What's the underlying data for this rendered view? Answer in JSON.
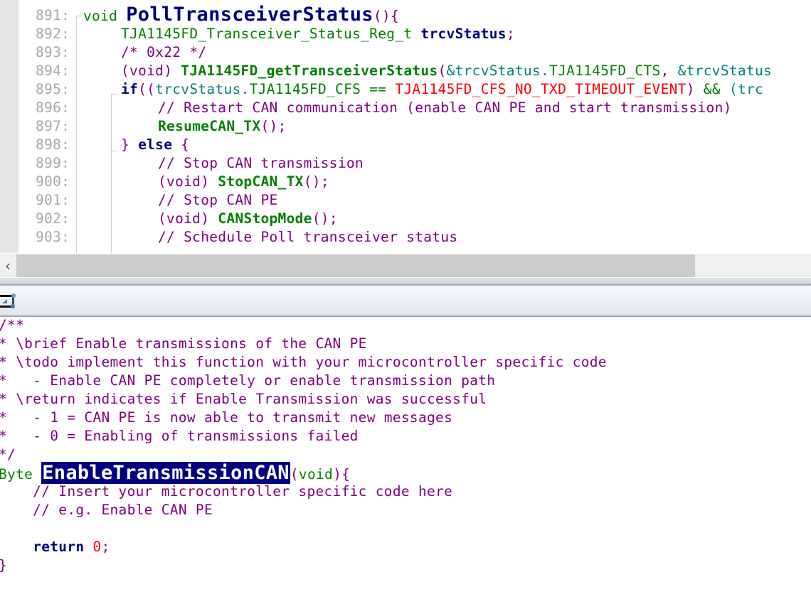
{
  "top_editor": {
    "lines": [
      {
        "num": "891:",
        "tokens": [
          {
            "t": "void ",
            "c": "ty"
          },
          {
            "t": "PollTransceiverStatus",
            "c": "fnbig"
          },
          {
            "t": "(){",
            "c": "pu"
          }
        ]
      },
      {
        "num": "892:",
        "tokens": [
          {
            "t": "TJA1145FD_Transceiver_Status_Reg_t ",
            "c": "ty"
          },
          {
            "t": "trcvStatus",
            "c": "var"
          },
          {
            "t": ";",
            "c": "pu"
          }
        ]
      },
      {
        "num": "893:",
        "tokens": [
          {
            "t": "/* 0x22 */",
            "c": "cm"
          }
        ]
      },
      {
        "num": "894:",
        "tokens": [
          {
            "t": "(void) ",
            "c": "pu"
          },
          {
            "t": "TJA1145FD_getTransceiverStatus",
            "c": "fn"
          },
          {
            "t": "(",
            "c": "pu"
          },
          {
            "t": "&trcvStatus.",
            "c": "id"
          },
          {
            "t": "TJA1145FD_CTS",
            "c": "ty"
          },
          {
            "t": ", ",
            "c": "pu"
          },
          {
            "t": "&trcvStatus",
            "c": "id"
          }
        ]
      },
      {
        "num": "895:",
        "tokens": [
          {
            "t": "if",
            "c": "kw"
          },
          {
            "t": "((",
            "c": "pu"
          },
          {
            "t": "trcvStatus.",
            "c": "id"
          },
          {
            "t": "TJA1145FD_CFS ",
            "c": "ty"
          },
          {
            "t": "== ",
            "c": "ty"
          },
          {
            "t": "TJA1145FD_CFS_NO_TXD_TIMEOUT_EVENT",
            "c": "red"
          },
          {
            "t": ") ",
            "c": "pu"
          },
          {
            "t": "&& ",
            "c": "ty"
          },
          {
            "t": "(trc",
            "c": "id"
          }
        ]
      },
      {
        "num": "896:",
        "tokens": [
          {
            "t": "// Restart CAN communication (enable CAN PE and start transmission)",
            "c": "cm"
          }
        ]
      },
      {
        "num": "897:",
        "tokens": [
          {
            "t": "ResumeCAN_TX",
            "c": "fn"
          },
          {
            "t": "();",
            "c": "pu"
          }
        ]
      },
      {
        "num": "898:",
        "tokens": [
          {
            "t": "} ",
            "c": "pu"
          },
          {
            "t": "else ",
            "c": "kw"
          },
          {
            "t": "{",
            "c": "pu"
          }
        ]
      },
      {
        "num": "899:",
        "tokens": [
          {
            "t": "// Stop CAN transmission",
            "c": "cm"
          }
        ]
      },
      {
        "num": "900:",
        "tokens": [
          {
            "t": "(void) ",
            "c": "pu"
          },
          {
            "t": "StopCAN_TX",
            "c": "fn"
          },
          {
            "t": "();",
            "c": "pu"
          }
        ]
      },
      {
        "num": "901:",
        "tokens": [
          {
            "t": "// Stop CAN PE",
            "c": "cm"
          }
        ]
      },
      {
        "num": "902:",
        "tokens": [
          {
            "t": "(void) ",
            "c": "pu"
          },
          {
            "t": "CANStopMode",
            "c": "fn"
          },
          {
            "t": "();",
            "c": "pu"
          }
        ]
      },
      {
        "num": "903:",
        "tokens": [
          {
            "t": "// Schedule Poll transceiver status",
            "c": "cm"
          }
        ]
      }
    ]
  },
  "scrollbar": {
    "left_arrow": "‹"
  },
  "toolbar": {
    "icon": "split-pane-icon"
  },
  "bottom_editor": {
    "lines": [
      {
        "tokens": [
          {
            "t": "/**",
            "c": "cm"
          }
        ]
      },
      {
        "tokens": [
          {
            "t": "* \\brief Enable transmissions of the CAN PE",
            "c": "cm"
          }
        ]
      },
      {
        "tokens": [
          {
            "t": "* \\todo implement this function with your microcontroller specific code",
            "c": "cm"
          }
        ]
      },
      {
        "tokens": [
          {
            "t": "*   - Enable CAN PE completely or enable transmission path",
            "c": "cm"
          }
        ]
      },
      {
        "tokens": [
          {
            "t": "* \\return indicates if Enable Transmission was successful",
            "c": "cm"
          }
        ]
      },
      {
        "tokens": [
          {
            "t": "*   - 1 = CAN PE is now able to transmit new messages",
            "c": "cm"
          }
        ]
      },
      {
        "tokens": [
          {
            "t": "*   - 0 = Enabling of transmissions failed",
            "c": "cm"
          }
        ]
      },
      {
        "tokens": [
          {
            "t": "*/",
            "c": "cm"
          }
        ]
      },
      {
        "tokens": [
          {
            "t": "Byte ",
            "c": "ty"
          },
          {
            "t": "EnableTransmissionCAN",
            "c": "hl"
          },
          {
            "t": "(",
            "c": "pu"
          },
          {
            "t": "void",
            "c": "ty"
          },
          {
            "t": "){",
            "c": "pu"
          }
        ]
      },
      {
        "tokens": [
          {
            "t": "    // Insert your microcontroller specific code here",
            "c": "cm"
          }
        ]
      },
      {
        "tokens": [
          {
            "t": "    // e.g. Enable CAN PE",
            "c": "cm"
          }
        ]
      },
      {
        "tokens": [
          {
            "t": "",
            "c": "cm"
          }
        ]
      },
      {
        "tokens": [
          {
            "t": "    return ",
            "c": "kw"
          },
          {
            "t": "0",
            "c": "red"
          },
          {
            "t": ";",
            "c": "pu"
          }
        ]
      },
      {
        "tokens": [
          {
            "t": "}",
            "c": "pu"
          }
        ]
      }
    ]
  }
}
